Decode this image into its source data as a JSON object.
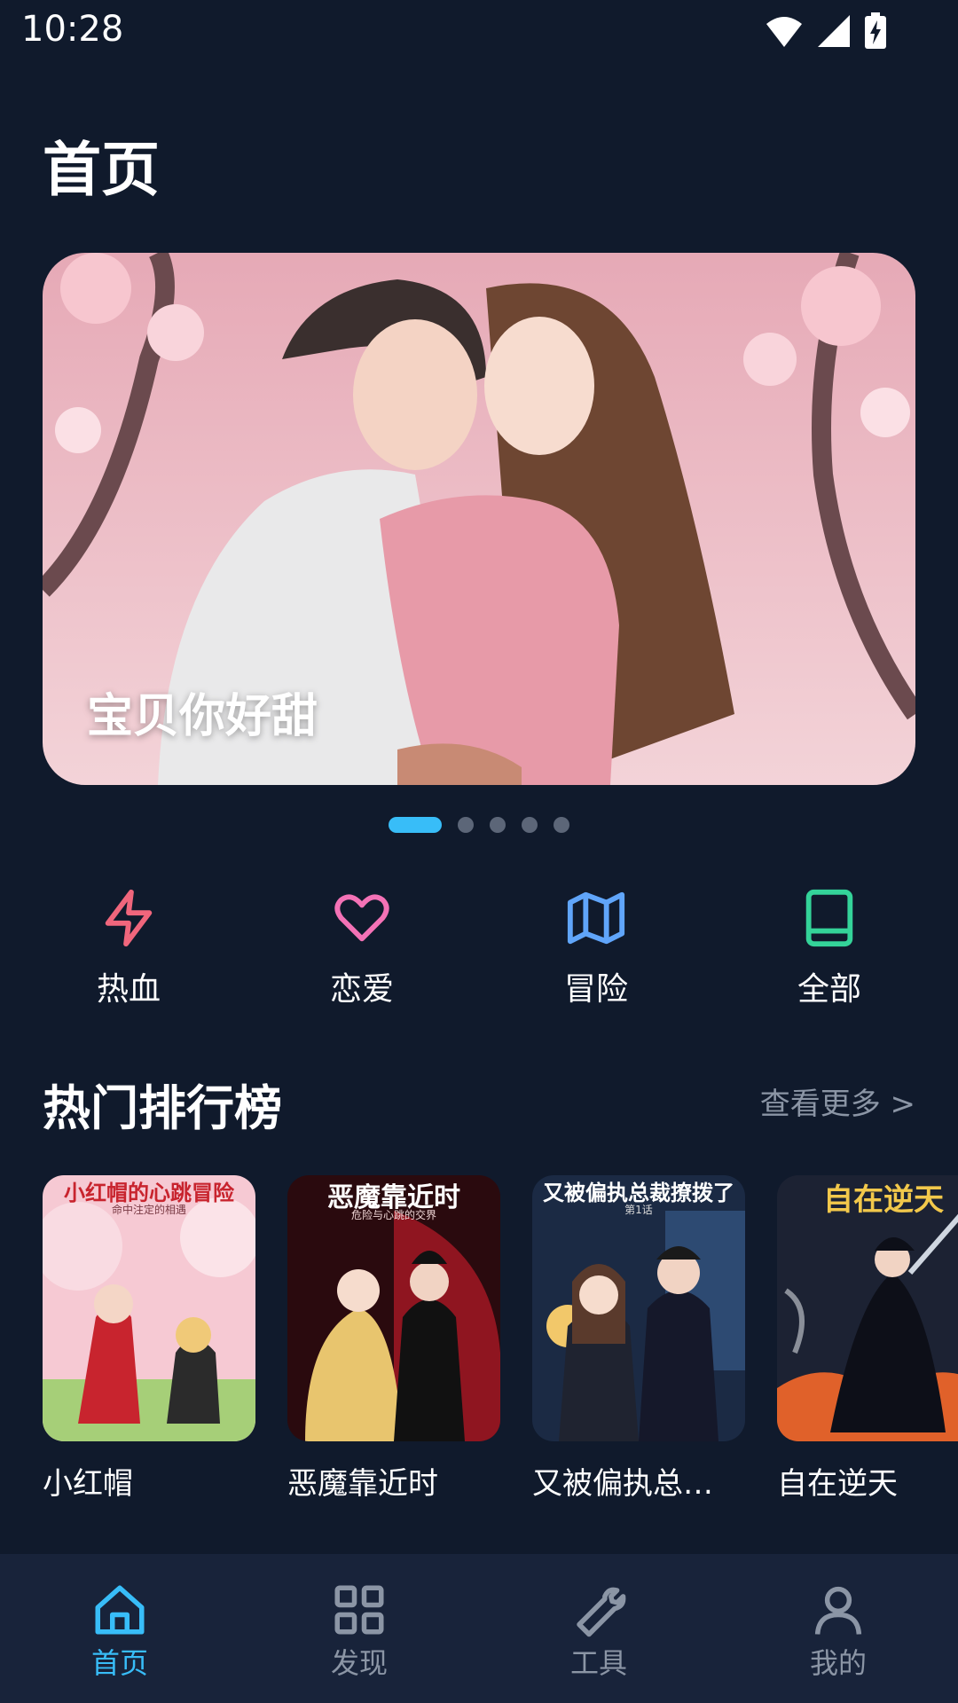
{
  "status_bar": {
    "time": "10:28"
  },
  "header": {
    "title": "首页"
  },
  "banner": {
    "title": "宝贝你好甜",
    "page_count": 5,
    "active_index": 0
  },
  "categories": [
    {
      "label": "热血",
      "icon": "lightning-icon",
      "color": "#f0667c"
    },
    {
      "label": "恋爱",
      "icon": "heart-icon",
      "color": "#f472b6"
    },
    {
      "label": "冒险",
      "icon": "map-icon",
      "color": "#60a5fa"
    },
    {
      "label": "全部",
      "icon": "book-icon",
      "color": "#34d399"
    }
  ],
  "ranking": {
    "title": "热门排行榜",
    "see_more": "查看更多 >",
    "items": [
      {
        "title": "小红帽",
        "cover_text": "小红帽的心跳冒险",
        "cover_subtext": "命中注定的相遇"
      },
      {
        "title": "恶魔靠近时",
        "cover_text": "恶魔靠近时",
        "cover_subtext": "危险与心跳的交界"
      },
      {
        "title": "又被偏执总…",
        "cover_text": "又被偏执总裁撩拨了",
        "cover_subtext": "第1话"
      },
      {
        "title": "自在逆天",
        "cover_text": "自在逆天",
        "cover_subtext": ""
      }
    ]
  },
  "bottom_nav": [
    {
      "label": "首页",
      "icon": "home-icon",
      "active": true
    },
    {
      "label": "发现",
      "icon": "grid-icon",
      "active": false
    },
    {
      "label": "工具",
      "icon": "wrench-icon",
      "active": false
    },
    {
      "label": "我的",
      "icon": "user-icon",
      "active": false
    }
  ],
  "colors": {
    "background": "#101a2c",
    "accent": "#38bdf8",
    "nav_background": "#18233a",
    "muted": "#8b95a5"
  }
}
